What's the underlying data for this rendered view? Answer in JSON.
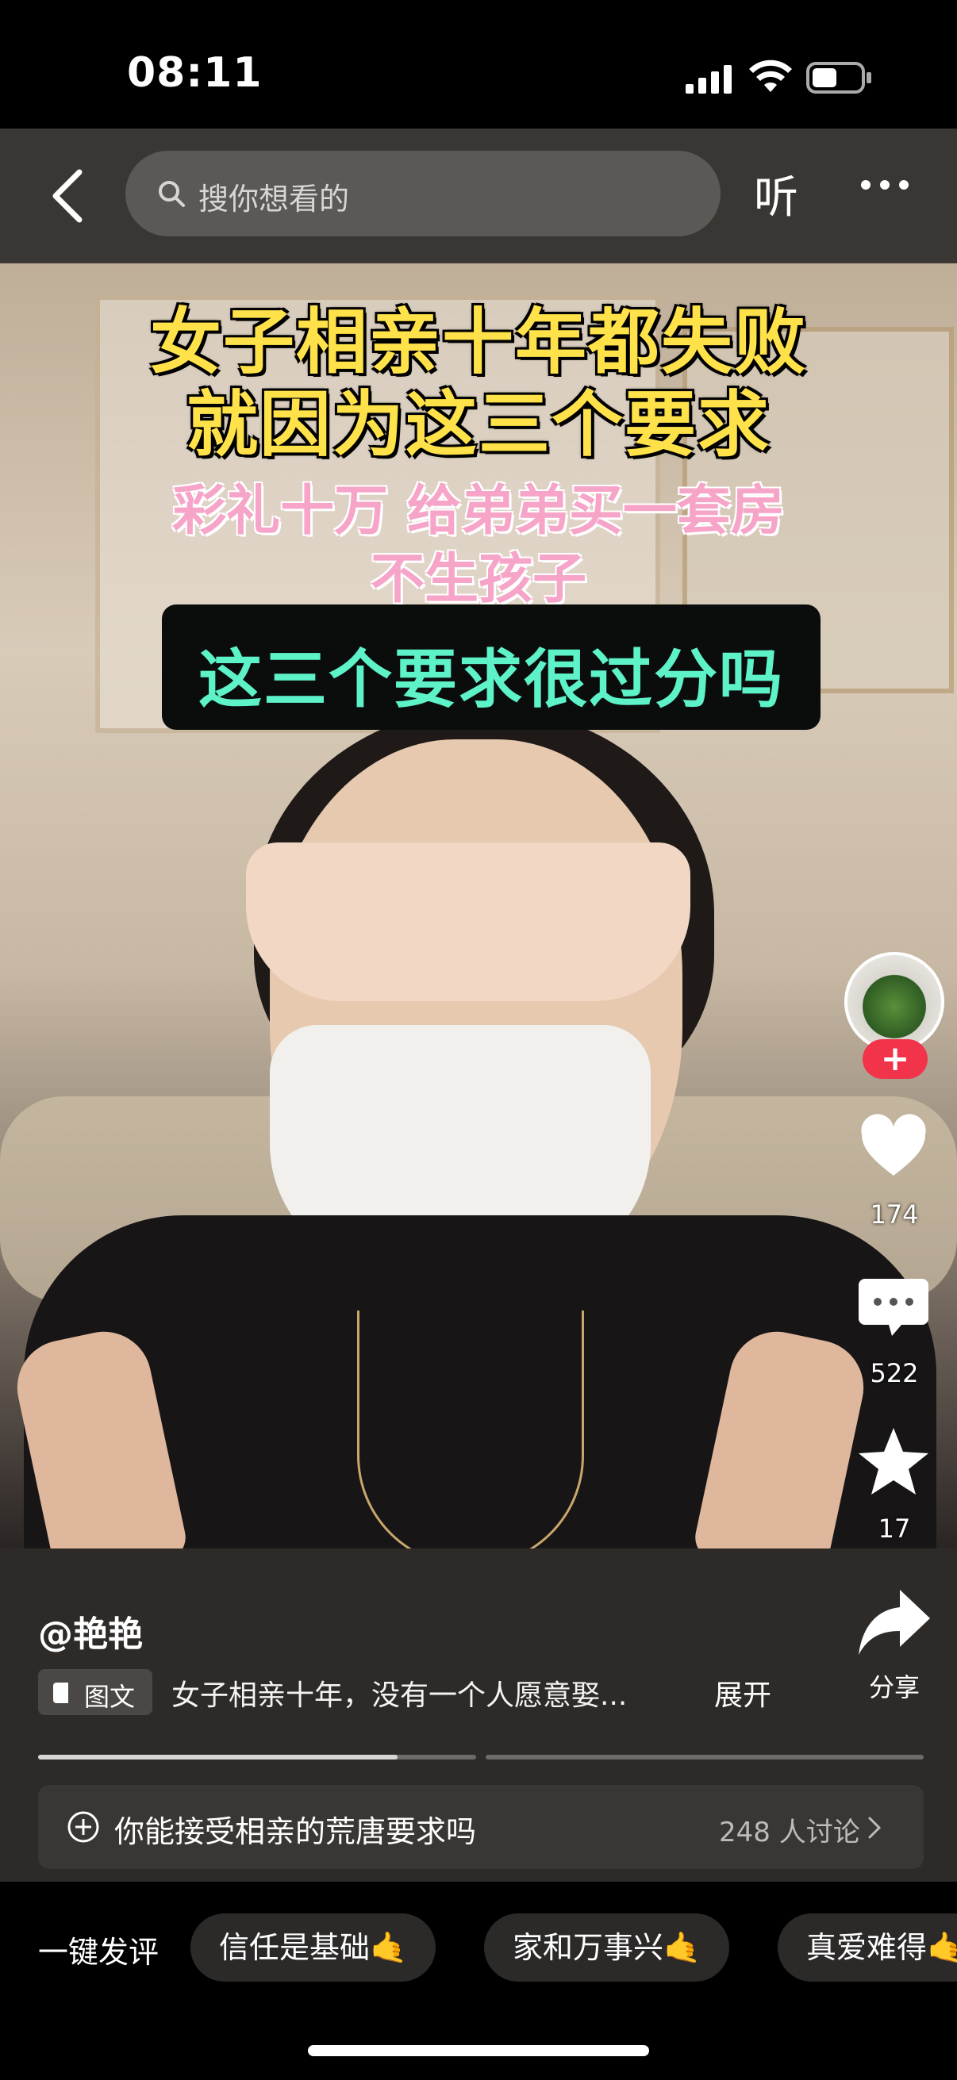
{
  "status_bar": {
    "time": "08:11"
  },
  "header": {
    "search_placeholder": "搜你想看的",
    "listen_label": "听"
  },
  "video": {
    "headline_line1": "女子相亲十年都失败",
    "headline_line2": "就因为这三个要求",
    "sub_line1": "彩礼十万 给弟弟买一套房",
    "sub_line2": "不生孩子",
    "banner": "这三个要求很过分吗"
  },
  "actions": {
    "like_count": "174",
    "comment_count": "522",
    "favorite_count": "17",
    "share_label": "分享"
  },
  "post": {
    "author": "@艳艳",
    "tag_label": "图文",
    "description": "女子相亲十年，没有一个人愿意娶...",
    "expand_label": "展开",
    "carousel_progress": [
      0.82,
      0.0
    ]
  },
  "topic": {
    "text": "你能接受相亲的荒唐要求吗",
    "count": "248 人讨论"
  },
  "quick_comment": {
    "label": "一键发评",
    "chips": [
      "信任是基础🤙",
      "家和万事兴🤙",
      "真爱难得🤙"
    ]
  },
  "colors": {
    "accent_red": "#f1344a",
    "headline_yellow": "#ffe24a",
    "subtitle_pink": "#f6a4c8",
    "banner_green": "#5df2c8"
  }
}
